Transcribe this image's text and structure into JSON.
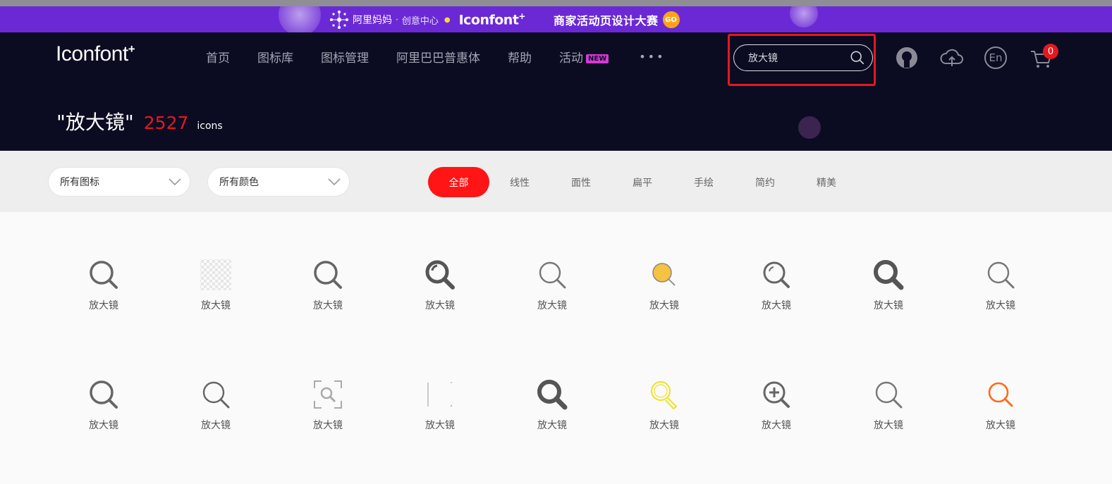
{
  "banner": {
    "brand": "阿里妈妈",
    "separator": "·",
    "subtitle": "创意中心",
    "logo_text": "Iconfont",
    "logo_plus": "+",
    "campaign_title": "商家活动页设计大赛",
    "go_label": "GO"
  },
  "header": {
    "logo_text": "Iconfont",
    "logo_plus": "+",
    "nav": [
      {
        "label": "首页"
      },
      {
        "label": "图标库"
      },
      {
        "label": "图标管理"
      },
      {
        "label": "阿里巴巴普惠体"
      },
      {
        "label": "帮助"
      },
      {
        "label": "活动"
      }
    ],
    "new_badge": "NEW",
    "more_label": "•••",
    "search": {
      "value": "放大镜",
      "icon": "search-icon"
    },
    "icons": [
      "github-icon",
      "upload-cloud-icon",
      "language-en-icon",
      "cart-icon"
    ],
    "lang_label": "En",
    "cart_count": "0"
  },
  "result": {
    "query": "\"放大镜\"",
    "count": "2527",
    "unit": "icons"
  },
  "filters": {
    "type_select": "所有图标",
    "color_select": "所有颜色",
    "tabs": [
      {
        "label": "全部"
      },
      {
        "label": "线性"
      },
      {
        "label": "面性"
      },
      {
        "label": "扁平"
      },
      {
        "label": "手绘"
      },
      {
        "label": "简约"
      },
      {
        "label": "精美"
      }
    ]
  },
  "icons": [
    {
      "label": "放大镜",
      "style": "outline-gray",
      "color": "#666666"
    },
    {
      "label": "放大镜",
      "style": "transparent-checker",
      "color": "#cccccc"
    },
    {
      "label": "放大镜",
      "style": "outline-gray",
      "color": "#666666"
    },
    {
      "label": "放大镜",
      "style": "solid-shine",
      "color": "#555555"
    },
    {
      "label": "放大镜",
      "style": "outline-thin",
      "color": "#777777"
    },
    {
      "label": "放大镜",
      "style": "yellow-fill",
      "color": "#f5c242"
    },
    {
      "label": "放大镜",
      "style": "outline-shine",
      "color": "#666666"
    },
    {
      "label": "放大镜",
      "style": "bold",
      "color": "#555555"
    },
    {
      "label": "放大镜",
      "style": "outline-thin",
      "color": "#777777"
    },
    {
      "label": "放大镜",
      "style": "outline-gray",
      "color": "#666666"
    },
    {
      "label": "放大镜",
      "style": "outline-thin",
      "color": "#666666"
    },
    {
      "label": "放大镜",
      "style": "frame-search",
      "color": "#aaaaaa"
    },
    {
      "label": "放大镜",
      "style": "faint-frame",
      "color": "#999999"
    },
    {
      "label": "放大镜",
      "style": "bold",
      "color": "#555555"
    },
    {
      "label": "放大镜",
      "style": "yellow-outline",
      "color": "#f2e021"
    },
    {
      "label": "放大镜",
      "style": "zoom-in",
      "color": "#666666"
    },
    {
      "label": "放大镜",
      "style": "outline-thin",
      "color": "#777777"
    },
    {
      "label": "放大镜",
      "style": "outline-orange",
      "color": "#ff6a1a"
    }
  ]
}
